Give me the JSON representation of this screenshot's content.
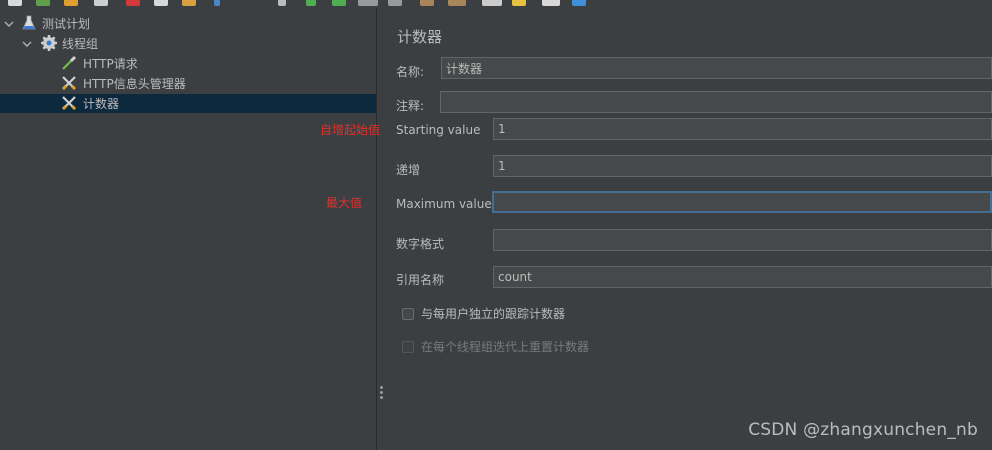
{
  "tree": {
    "items": [
      {
        "label": "测试计划",
        "icon": "flask-icon"
      },
      {
        "label": "线程组",
        "icon": "gear-icon"
      },
      {
        "label": "HTTP请求",
        "icon": "pipette-icon"
      },
      {
        "label": "HTTP信息头管理器",
        "icon": "tools-icon"
      },
      {
        "label": "计数器",
        "icon": "tools-icon"
      }
    ]
  },
  "form": {
    "title": "计数器",
    "name_label": "名称:",
    "name_value": "计数器",
    "comment_label": "注释:",
    "comment_value": "",
    "start_label": "Starting value",
    "start_value": "1",
    "increment_label": "递增",
    "increment_value": "1",
    "max_label": "Maximum value",
    "max_value": "",
    "format_label": "数字格式",
    "format_value": "",
    "ref_label": "引用名称",
    "ref_value": "count",
    "per_user_label": "与每用户独立的跟踪计数器",
    "reset_label": "在每个线程组迭代上重置计数器"
  },
  "annotations": {
    "start": "自增起始值",
    "max": "最大值"
  },
  "watermark": "CSDN @zhangxunchen_nb",
  "colors": {
    "background": "#3c3f41",
    "selection": "#0d293e",
    "input_bg": "#45494a",
    "focus_border": "#466d94",
    "annotation_red": "#e2302c"
  }
}
